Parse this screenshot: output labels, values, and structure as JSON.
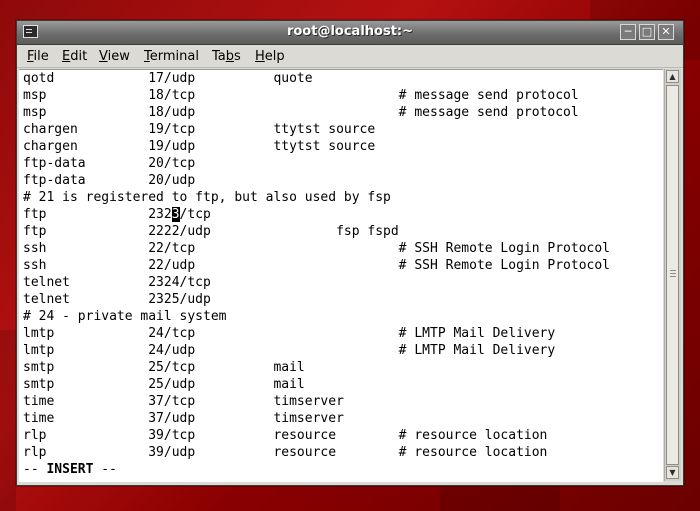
{
  "window": {
    "title": "root@localhost:~"
  },
  "menu": [
    "File",
    "Edit",
    "View",
    "Terminal",
    "Tabs",
    "Help"
  ],
  "menu_mnemonics": [
    "F",
    "E",
    "V",
    "T",
    "b",
    "H"
  ],
  "terminal": {
    "lines": [
      "qotd            17/udp          quote",
      "msp             18/tcp                          # message send protocol",
      "msp             18/udp                          # message send protocol",
      "chargen         19/tcp          ttytst source",
      "chargen         19/udp          ttytst source",
      "ftp-data        20/tcp",
      "ftp-data        20/udp",
      "# 21 is registered to ftp, but also used by fsp",
      "",
      "ftp             2222/udp                fsp fspd",
      "ssh             22/tcp                          # SSH Remote Login Protocol",
      "ssh             22/udp                          # SSH Remote Login Protocol",
      "telnet          2324/tcp",
      "telnet          2325/udp",
      "# 24 - private mail system",
      "lmtp            24/tcp                          # LMTP Mail Delivery",
      "lmtp            24/udp                          # LMTP Mail Delivery",
      "smtp            25/tcp          mail",
      "smtp            25/udp          mail",
      "time            37/tcp          timserver",
      "time            37/udp          timserver",
      "rlp             39/tcp          resource        # resource location",
      "rlp             39/udp          resource        # resource location"
    ],
    "cursor_line": {
      "before": "ftp             232",
      "cursor_char": "3",
      "after": "/tcp"
    },
    "status": {
      "prefix": "-- ",
      "mode": "INSERT",
      "suffix": " --"
    }
  },
  "colors": {
    "desktop": "#b51111",
    "titlebar": "#6e6e6e",
    "window_bg": "#dcdad5",
    "terminal_bg": "#ffffff",
    "terminal_fg": "#000000"
  },
  "icons": {
    "title_icon": "terminal-icon",
    "minimize": "minimize-icon",
    "maximize": "maximize-icon",
    "close": "close-icon",
    "scroll_up": "arrow-up-icon",
    "scroll_down": "arrow-down-icon"
  }
}
